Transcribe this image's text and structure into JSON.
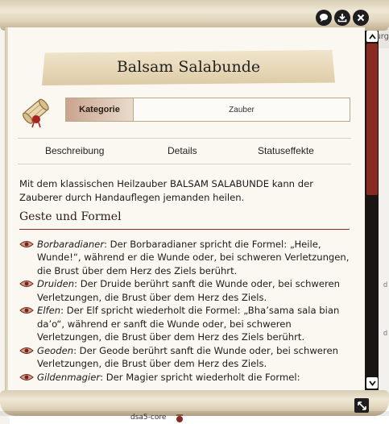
{
  "window": {
    "title": "Balsam Salabunde",
    "buttons": [
      {
        "name": "chat-icon"
      },
      {
        "name": "download-icon"
      },
      {
        "name": "close-icon"
      }
    ]
  },
  "background": {
    "right_top_text": "urg",
    "right_side_d1": "d",
    "right_side_d2": "d",
    "bottom_label": "dsa5-core"
  },
  "category": {
    "label": "Kategorie",
    "value": "Zauber"
  },
  "tabs": [
    {
      "label": "Beschreibung"
    },
    {
      "label": "Details"
    },
    {
      "label": "Statuseffekte"
    }
  ],
  "description": {
    "intro": "Mit dem klassischen Heilzauber BALSAM SALABUNDE kann der Zauberer durch Handauflegen jemanden heilen.",
    "section_heading": "Geste und Formel",
    "entries": [
      {
        "name": "Borbaradianer",
        "text": ": Der Borbaradianer spricht die Formel: „Heile, Wunde!“, während er die Wunde oder, bei schweren Verletzungen, die Brust über dem Herz des Ziels berührt."
      },
      {
        "name": "Druiden",
        "text": ": Der Druide berührt sanft die Wunde oder, bei schweren Verletzungen, die Brust über dem Herz des Ziels."
      },
      {
        "name": "Elfen",
        "text": ": Der Elf spricht wiederholt die Formel: „Bha’sama sala bian da’o“, während er sanft die Wunde oder, bei schweren Verletzungen, die Brust über dem Herz des Ziels berührt."
      },
      {
        "name": "Geoden",
        "text": ": Der Geode berührt sanft die Wunde oder, bei schweren Verletzungen, die Brust über dem Herz des Ziels."
      },
      {
        "name": "Gildenmagier",
        "text": ": Der Magier spricht wiederholt die Formel:"
      }
    ]
  },
  "colors": {
    "accent": "#8a2a22",
    "parchment": "#fbf8f1"
  }
}
